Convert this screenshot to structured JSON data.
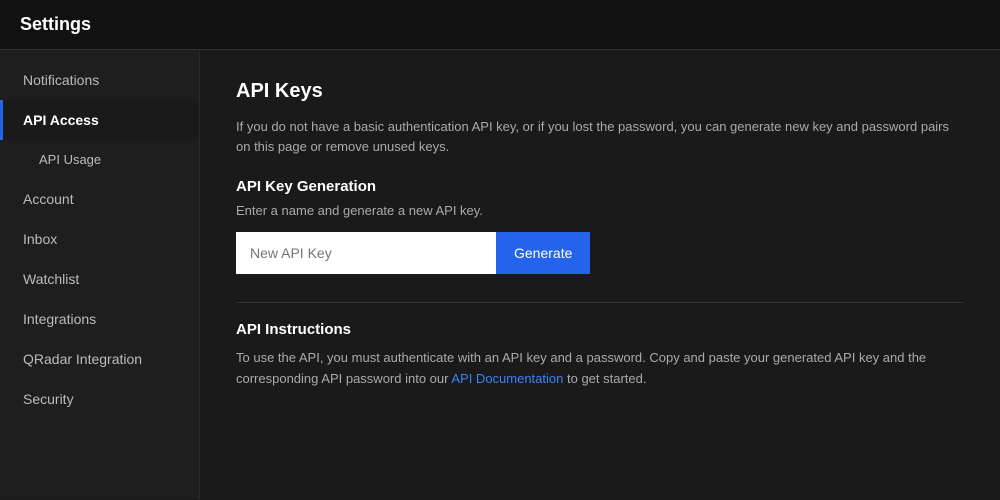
{
  "header": {
    "title": "Settings"
  },
  "sidebar": {
    "items": [
      {
        "id": "notifications",
        "label": "Notifications",
        "active": false,
        "sub": false
      },
      {
        "id": "api-access",
        "label": "API Access",
        "active": true,
        "sub": false
      },
      {
        "id": "api-usage",
        "label": "API Usage",
        "active": false,
        "sub": true
      },
      {
        "id": "account",
        "label": "Account",
        "active": false,
        "sub": false
      },
      {
        "id": "inbox",
        "label": "Inbox",
        "active": false,
        "sub": false
      },
      {
        "id": "watchlist",
        "label": "Watchlist",
        "active": false,
        "sub": false
      },
      {
        "id": "integrations",
        "label": "Integrations",
        "active": false,
        "sub": false
      },
      {
        "id": "qradar-integration",
        "label": "QRadar Integration",
        "active": false,
        "sub": false
      },
      {
        "id": "security",
        "label": "Security",
        "active": false,
        "sub": false
      }
    ]
  },
  "main": {
    "section_title": "API Keys",
    "description": "If you do not have a basic authentication API key, or if you lost the password, you can generate new key and password pairs on this page or remove unused keys.",
    "api_key_generation": {
      "title": "API Key Generation",
      "subtitle": "Enter a name and generate a new API key.",
      "input_placeholder": "New API Key",
      "button_label": "Generate"
    },
    "api_instructions": {
      "title": "API Instructions",
      "text_before_link": "To use the API, you must authenticate with an API key and a password. Copy and paste your generated API key and the corresponding API password into our ",
      "link_label": "API Documentation",
      "text_after_link": " to get started."
    }
  }
}
